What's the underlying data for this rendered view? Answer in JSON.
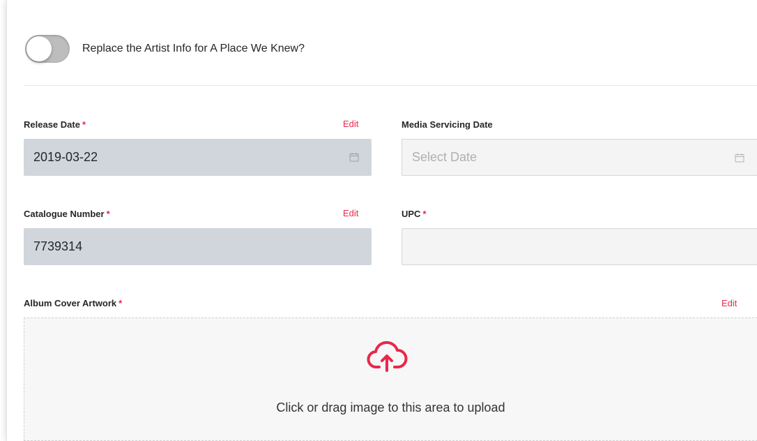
{
  "artist_toggle": {
    "label": "Replace the Artist Info for A Place We Knew?",
    "checked": false
  },
  "fields": {
    "release_date": {
      "label": "Release Date",
      "required_mark": "*",
      "edit_label": "Edit",
      "value": "2019-03-22",
      "icon": "calendar-icon"
    },
    "media_servicing_date": {
      "label": "Media Servicing Date",
      "placeholder": "Select Date",
      "icon": "calendar-icon"
    },
    "catalogue_number": {
      "label": "Catalogue Number",
      "required_mark": "*",
      "edit_label": "Edit",
      "value": "7739314"
    },
    "upc": {
      "label": "UPC",
      "required_mark": "*",
      "value": ""
    }
  },
  "artwork": {
    "label": "Album Cover Artwork",
    "required_mark": "*",
    "edit_label": "Edit",
    "upload_text": "Click or drag image to this area to upload",
    "icon": "cloud-upload-icon"
  },
  "colors": {
    "accent": "#e8284a",
    "filled_input_bg": "#d1d6dc",
    "empty_input_bg": "#f4f4f4"
  }
}
